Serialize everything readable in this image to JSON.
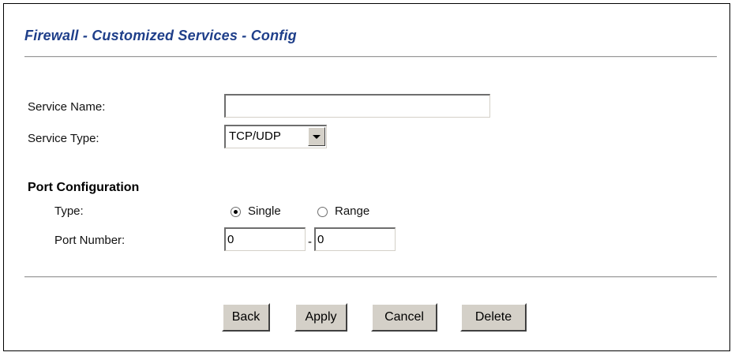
{
  "page": {
    "title": "Firewall - Customized Services - Config"
  },
  "form": {
    "service_name_label": "Service Name:",
    "service_name_value": "",
    "service_type_label": "Service Type:",
    "service_type_value": "TCP/UDP",
    "port_config_heading": "Port Configuration",
    "type_label": "Type:",
    "type_options": [
      "Single",
      "Range"
    ],
    "type_selected": "Single",
    "port_number_label": "Port Number:",
    "port_start_value": "0",
    "port_separator": "-",
    "port_end_value": "0"
  },
  "buttons": {
    "back": "Back",
    "apply": "Apply",
    "cancel": "Cancel",
    "delete": "Delete"
  },
  "colors": {
    "title": "#1f3f8a",
    "button_face": "#d4d0c8"
  }
}
